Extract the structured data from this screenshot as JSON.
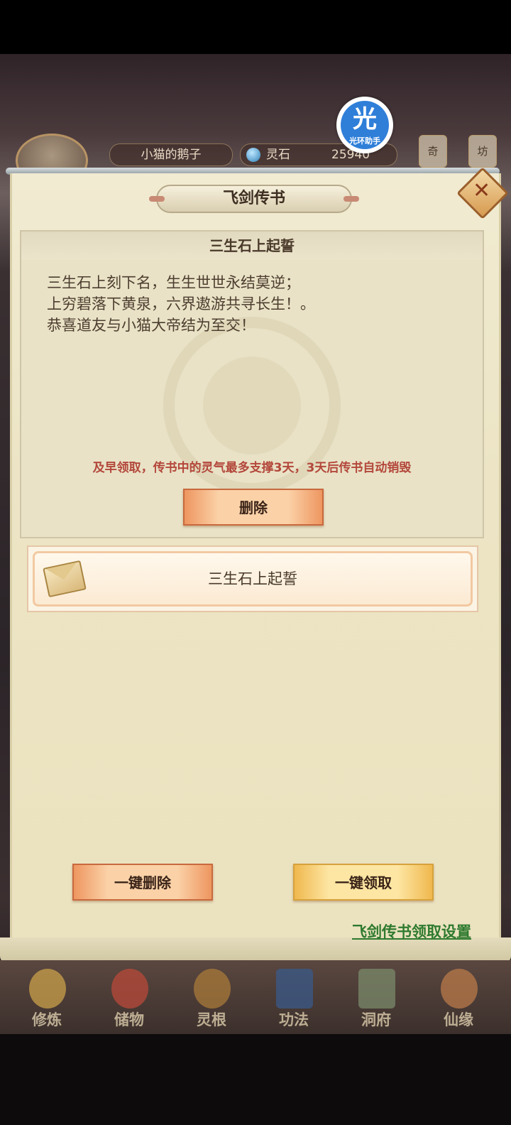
{
  "hud": {
    "player_name": "小猫的鹅子",
    "stone_label": "灵石",
    "stone_amount": "25940",
    "side_buttons": [
      "奇",
      "坊"
    ]
  },
  "badge": {
    "glyph": "光",
    "label": "光环助手"
  },
  "dialog": {
    "title": "飞剑传书",
    "close_icon": "close-icon",
    "letter": {
      "subject": "三生石上起誓",
      "lines": [
        "三生石上刻下名，生生世世永结莫逆；",
        "上穷碧落下黄泉，六界遨游共寻长生！。",
        "恭喜道友与小猫大帝结为至交！"
      ],
      "warning": "及早领取，传书中的灵气最多支撑3天，3天后传书自动销毁",
      "delete_label": "删除"
    },
    "list": [
      {
        "icon": "envelope-icon",
        "title": "三生石上起誓"
      }
    ],
    "delete_all_label": "一键删除",
    "claim_all_label": "一键领取",
    "settings_link": "飞剑传书领取设置"
  },
  "nav": {
    "items": [
      {
        "label": "修炼",
        "color": "#c9a04a"
      },
      {
        "label": "储物",
        "color": "#b84a3a"
      },
      {
        "label": "灵根",
        "color": "#a87a3a"
      },
      {
        "label": "功法",
        "color": "#3a5a8a"
      },
      {
        "label": "洞府",
        "color": "#7a8a6a"
      },
      {
        "label": "仙缘",
        "color": "#b87a4a"
      }
    ]
  }
}
